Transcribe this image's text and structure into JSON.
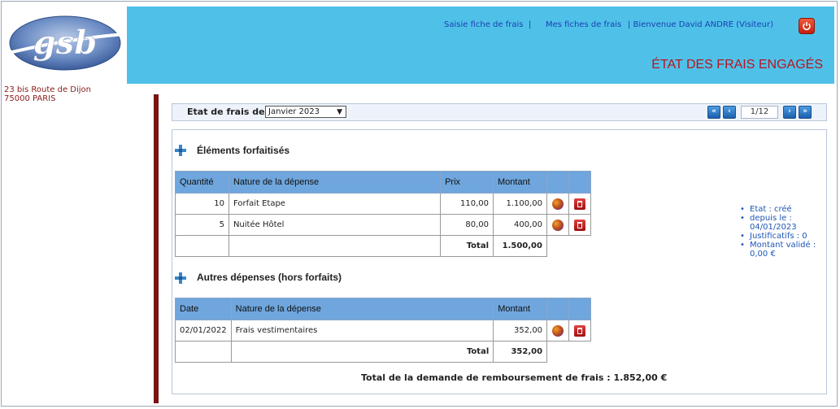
{
  "company": {
    "logo_text": "gsb",
    "address_line1": "23 bis Route de Dijon",
    "address_line2": "75000 PARIS"
  },
  "nav": {
    "saisie": "Saisie fiche de frais",
    "sep1": "|",
    "mes_fiches": "Mes fiches de frais",
    "welcome": "| Bienvenue David ANDRE (Visiteur)"
  },
  "page_title": "ÉTAT DES FRAIS ENGAGÉS",
  "period": {
    "label": "Etat de frais de",
    "selected": "Janvier 2023",
    "pager_value": "1/12"
  },
  "forfait": {
    "title": "Éléments forfaitisés",
    "headers": [
      "Quantité",
      "Nature de la dépense",
      "Prix",
      "Montant"
    ],
    "rows": [
      {
        "qty": "10",
        "nature": "Forfait Etape",
        "prix": "110,00",
        "montant": "1.100,00"
      },
      {
        "qty": "5",
        "nature": "Nuitée Hôtel",
        "prix": "80,00",
        "montant": "400,00"
      }
    ],
    "total_label": "Total",
    "total_value": "1.500,00"
  },
  "hors_forfait": {
    "title": "Autres dépenses (hors forfaits)",
    "headers": [
      "Date",
      "Nature de la dépense",
      "Montant"
    ],
    "rows": [
      {
        "date": "02/01/2022",
        "nature": "Frais vestimentaires",
        "montant": "352,00"
      }
    ],
    "total_label": "Total",
    "total_value": "352,00"
  },
  "status": {
    "etat": "Etat : créé",
    "depuis_label": "depuis le :",
    "depuis_date": "04/01/2023",
    "justificatifs": "Justificatifs : 0",
    "montant_label": "Montant validé :",
    "montant_value": "0,00 €"
  },
  "grand_total": "Total de la demande de remboursement de frais : 1.852,00 €",
  "colors": {
    "header_bg": "#4fc1e9",
    "title_red": "#b8141e",
    "table_header": "#6fa6dd",
    "sidebar_bar": "#7a1212",
    "link_blue": "#1a3fb0"
  }
}
